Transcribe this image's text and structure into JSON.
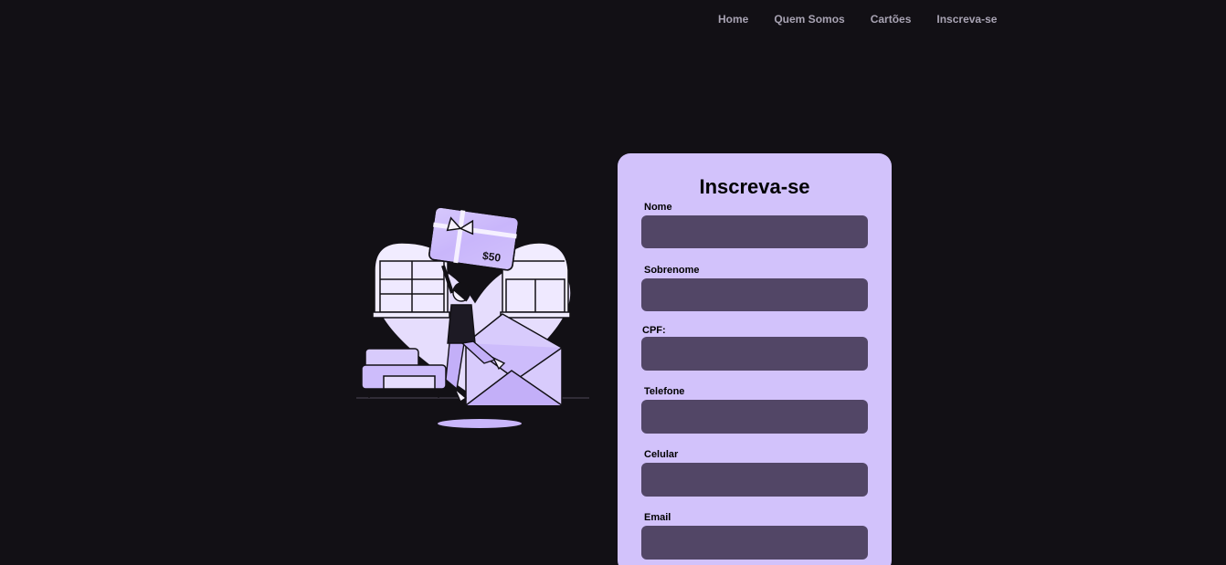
{
  "nav": {
    "items": [
      "Home",
      "Quem Somos",
      "Cartões",
      "Inscreva-se"
    ]
  },
  "illustration": {
    "gift_card_value": "$50"
  },
  "form": {
    "title": "Inscreva-se",
    "fields": [
      {
        "label": "Nome",
        "value": ""
      },
      {
        "label": "Sobrenome",
        "value": ""
      },
      {
        "label": "CPF:",
        "value": ""
      },
      {
        "label": "Telefone",
        "value": ""
      },
      {
        "label": "Celular",
        "value": ""
      },
      {
        "label": "Email",
        "value": ""
      }
    ]
  },
  "colors": {
    "background": "#121015",
    "card": "#d2c2fb",
    "input": "#524666",
    "nav_text": "#a8a3b3",
    "accent": "#c9b6fb"
  }
}
